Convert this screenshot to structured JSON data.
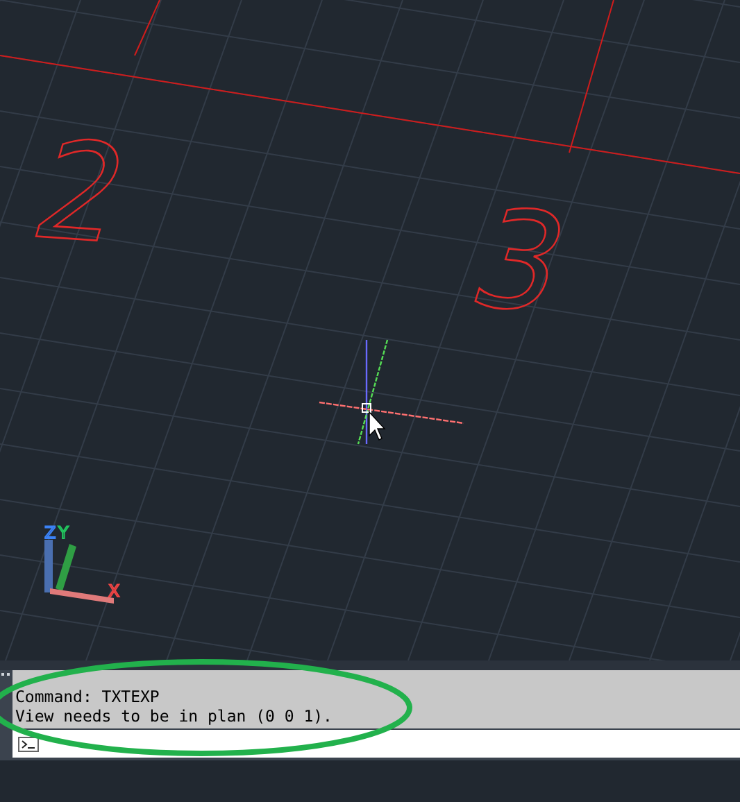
{
  "viewport": {
    "canvas_labels": [
      {
        "text": "2"
      },
      {
        "text": "3"
      }
    ],
    "ucs_axes": [
      {
        "label": "Z"
      },
      {
        "label": "Y"
      },
      {
        "label": "X"
      }
    ]
  },
  "command_line": {
    "history": [
      "Command: TXTEXP",
      "View needs to be in plan (0 0 1)."
    ]
  }
}
